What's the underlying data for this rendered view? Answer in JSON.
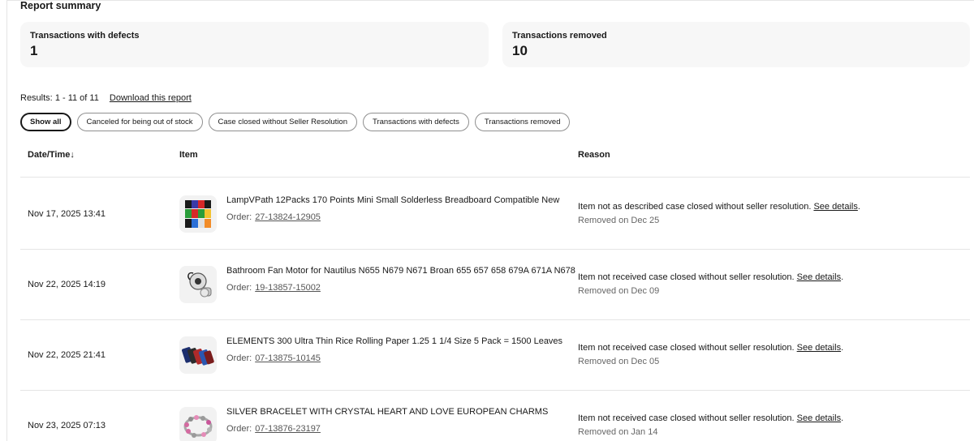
{
  "summary": {
    "title": "Report summary",
    "cards": [
      {
        "label": "Transactions with defects",
        "value": "1"
      },
      {
        "label": "Transactions removed",
        "value": "10"
      }
    ]
  },
  "results": {
    "label": "Results:",
    "range": "1 - 11 of 11",
    "download_label": "Download this report"
  },
  "filters": [
    {
      "label": "Show all",
      "active": true
    },
    {
      "label": "Canceled for being out of stock",
      "active": false
    },
    {
      "label": "Case closed without Seller Resolution",
      "active": false
    },
    {
      "label": "Transactions with defects",
      "active": false
    },
    {
      "label": "Transactions removed",
      "active": false
    }
  ],
  "table": {
    "headers": {
      "date": "Date/Time",
      "date_sort_icon": "↓",
      "item": "Item",
      "reason": "Reason"
    },
    "order_label": "Order:",
    "rows": [
      {
        "date": "Nov 17, 2025 13:41",
        "title": "LampVPath 12Packs 170 Points Mini Small Solderless Breadboard Compatible New",
        "order": "27-13824-12905",
        "reason": "Item not as described case closed without seller resolution.",
        "details": "See details",
        "removed": "Removed on Dec 25",
        "thumb_icon": "breadboard-thumbnail"
      },
      {
        "date": "Nov 22, 2025 14:19",
        "title": "Bathroom Fan Motor for Nautilus N655 N679 N671 Broan 655 657 658 679A 671A N678",
        "order": "19-13857-15002",
        "reason": "Item not received case closed without seller resolution.",
        "details": "See details",
        "removed": "Removed on Dec 09",
        "thumb_icon": "fan-motor-thumbnail"
      },
      {
        "date": "Nov 22, 2025 21:41",
        "title": "ELEMENTS 300 Ultra Thin Rice Rolling Paper 1.25 1 1/4 Size 5 Pack = 1500 Leaves",
        "order": "07-13875-10145",
        "reason": "Item not received case closed without seller resolution.",
        "details": "See details",
        "removed": "Removed on Dec 05",
        "thumb_icon": "rolling-paper-thumbnail"
      },
      {
        "date": "Nov 23, 2025 07:13",
        "title": "SILVER BRACELET WITH CRYSTAL HEART AND LOVE EUROPEAN CHARMS",
        "order": "07-13876-23197",
        "reason": "Item not received case closed without seller resolution.",
        "details": "See details",
        "removed": "Removed on Jan 14",
        "thumb_icon": "bracelet-thumbnail"
      }
    ]
  }
}
